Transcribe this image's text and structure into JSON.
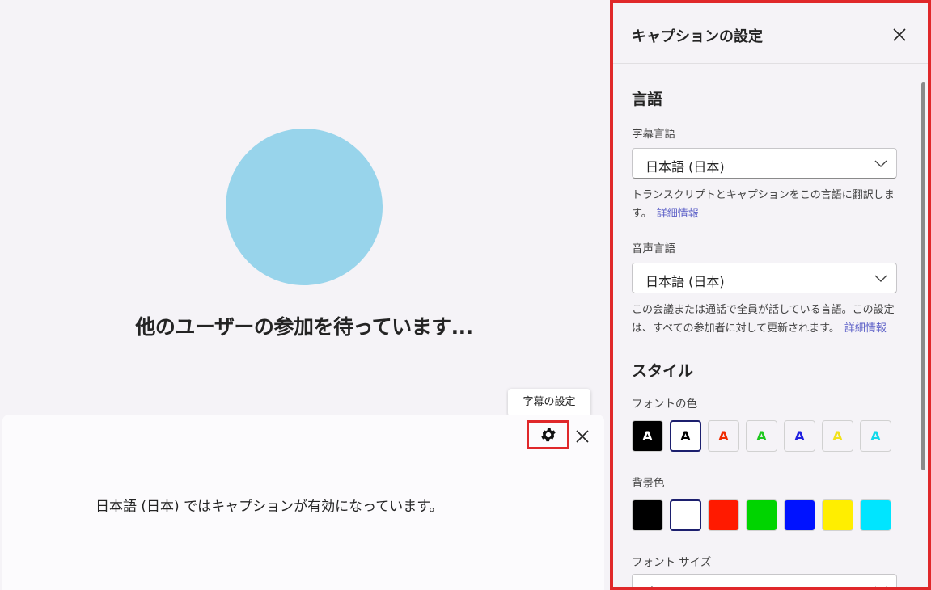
{
  "stage": {
    "waiting_text": "他のユーザーの参加を待っています...",
    "avatar_color": "#98d4eb"
  },
  "caption_bar": {
    "tooltip": "字幕の設定",
    "status_text": "日本語 (日本) ではキャプションが有効になっています。",
    "settings_icon": "gear-icon",
    "close_icon": "close-icon"
  },
  "panel": {
    "title": "キャプションの設定",
    "language_heading": "言語",
    "subtitle_language": {
      "label": "字幕言語",
      "value": "日本語 (日本)",
      "help": "トランスクリプトとキャプションをこの言語に翻訳します。",
      "link": "詳細情報"
    },
    "spoken_language": {
      "label": "音声言語",
      "value": "日本語 (日本)",
      "help": "この会議または通話で全員が話している言語。この設定は、すべての参加者に対して更新されます。",
      "link": "詳細情報"
    },
    "style_heading": "スタイル",
    "font_color": {
      "label": "フォントの色",
      "options": [
        {
          "letter": "A",
          "color": "#ffffff",
          "bg": "#000000",
          "selected": false
        },
        {
          "letter": "A",
          "color": "#000000",
          "bg": "#ffffff",
          "selected": true
        },
        {
          "letter": "A",
          "color": "#f02b00",
          "bg": "#f5f3f7",
          "selected": false
        },
        {
          "letter": "A",
          "color": "#1ec81e",
          "bg": "#f5f3f7",
          "selected": false
        },
        {
          "letter": "A",
          "color": "#2020e0",
          "bg": "#f5f3f7",
          "selected": false
        },
        {
          "letter": "A",
          "color": "#f2e21a",
          "bg": "#f5f3f7",
          "selected": false
        },
        {
          "letter": "A",
          "color": "#12d8ea",
          "bg": "#f5f3f7",
          "selected": false
        }
      ]
    },
    "background_color": {
      "label": "背景色",
      "options": [
        {
          "color": "#000000",
          "selected": false
        },
        {
          "color": "#ffffff",
          "selected": true
        },
        {
          "color": "#ff1a00",
          "selected": false
        },
        {
          "color": "#00d400",
          "selected": false
        },
        {
          "color": "#0012ff",
          "selected": false
        },
        {
          "color": "#ffee00",
          "selected": false
        },
        {
          "color": "#00e5ff",
          "selected": false
        }
      ]
    },
    "font_size": {
      "label": "フォント サイズ",
      "value": "中"
    }
  },
  "colors": {
    "highlight_border": "#e0282a",
    "link": "#5b5fc7"
  }
}
